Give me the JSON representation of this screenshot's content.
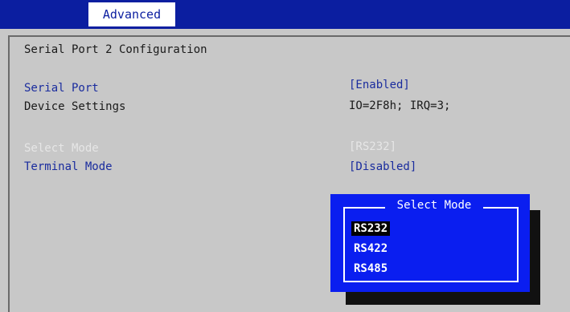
{
  "tabs": [
    {
      "label": "Advanced",
      "active": true
    }
  ],
  "page": {
    "title": "Serial Port 2 Configuration"
  },
  "settings": [
    {
      "label": "Serial Port",
      "value": "[Enabled]"
    },
    {
      "label": "Device Settings",
      "value": "IO=2F8h; IRQ=3;"
    },
    {
      "label": "Select Mode",
      "value": "[RS232]"
    },
    {
      "label": "Terminal Mode",
      "value": "[Disabled]"
    }
  ],
  "popup": {
    "title": "Select Mode",
    "options": [
      "RS232",
      "RS422",
      "RS485"
    ],
    "selected": "RS232"
  },
  "colors": {
    "header_bg": "#0b1ea0",
    "panel_bg": "#c8c8c8",
    "label_blue": "#1a2c9e",
    "popup_bg": "#0a1ef0",
    "selection_bg": "#000000"
  }
}
